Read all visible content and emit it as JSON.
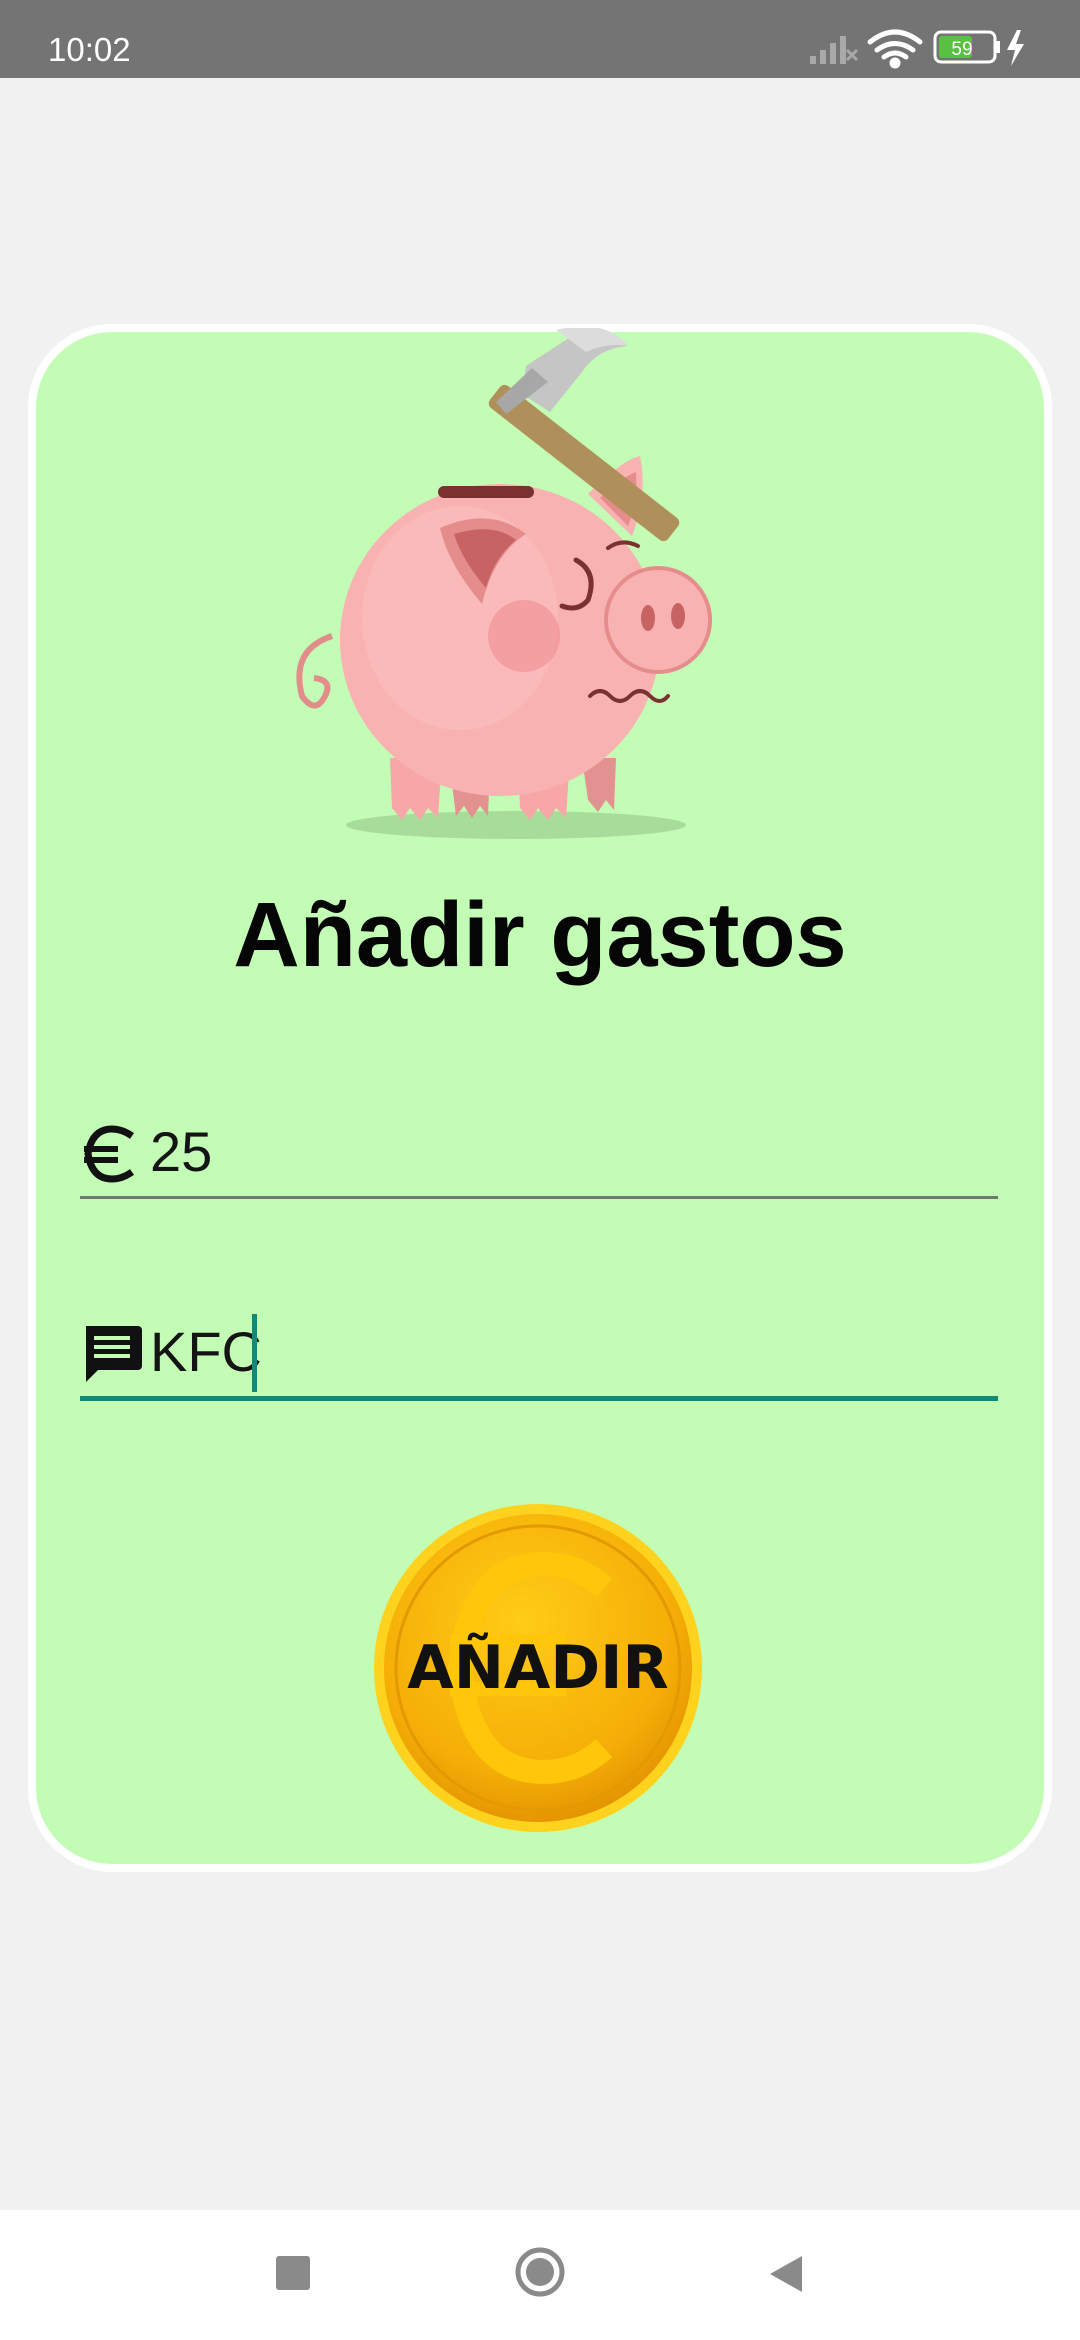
{
  "status_bar": {
    "time": "10:02",
    "battery_level": "59",
    "icons": [
      "signal-icon",
      "wifi-icon",
      "battery-icon",
      "charging-icon"
    ]
  },
  "card": {
    "illustration": "piggy-bank-hammer-illustration",
    "title": "Añadir gastos"
  },
  "form": {
    "amount": {
      "icon": "euro-icon",
      "value": "25"
    },
    "note": {
      "icon": "message-icon",
      "value": "KFC"
    }
  },
  "add_button": {
    "label": "AÑADIR"
  },
  "nav_bar": {
    "buttons": [
      "recents-square-icon",
      "home-circle-icon",
      "back-triangle-icon"
    ]
  },
  "colors": {
    "card_background": "#c3fcb5",
    "focused_underline": "#138a78",
    "coin_gold": "#f3a800"
  }
}
